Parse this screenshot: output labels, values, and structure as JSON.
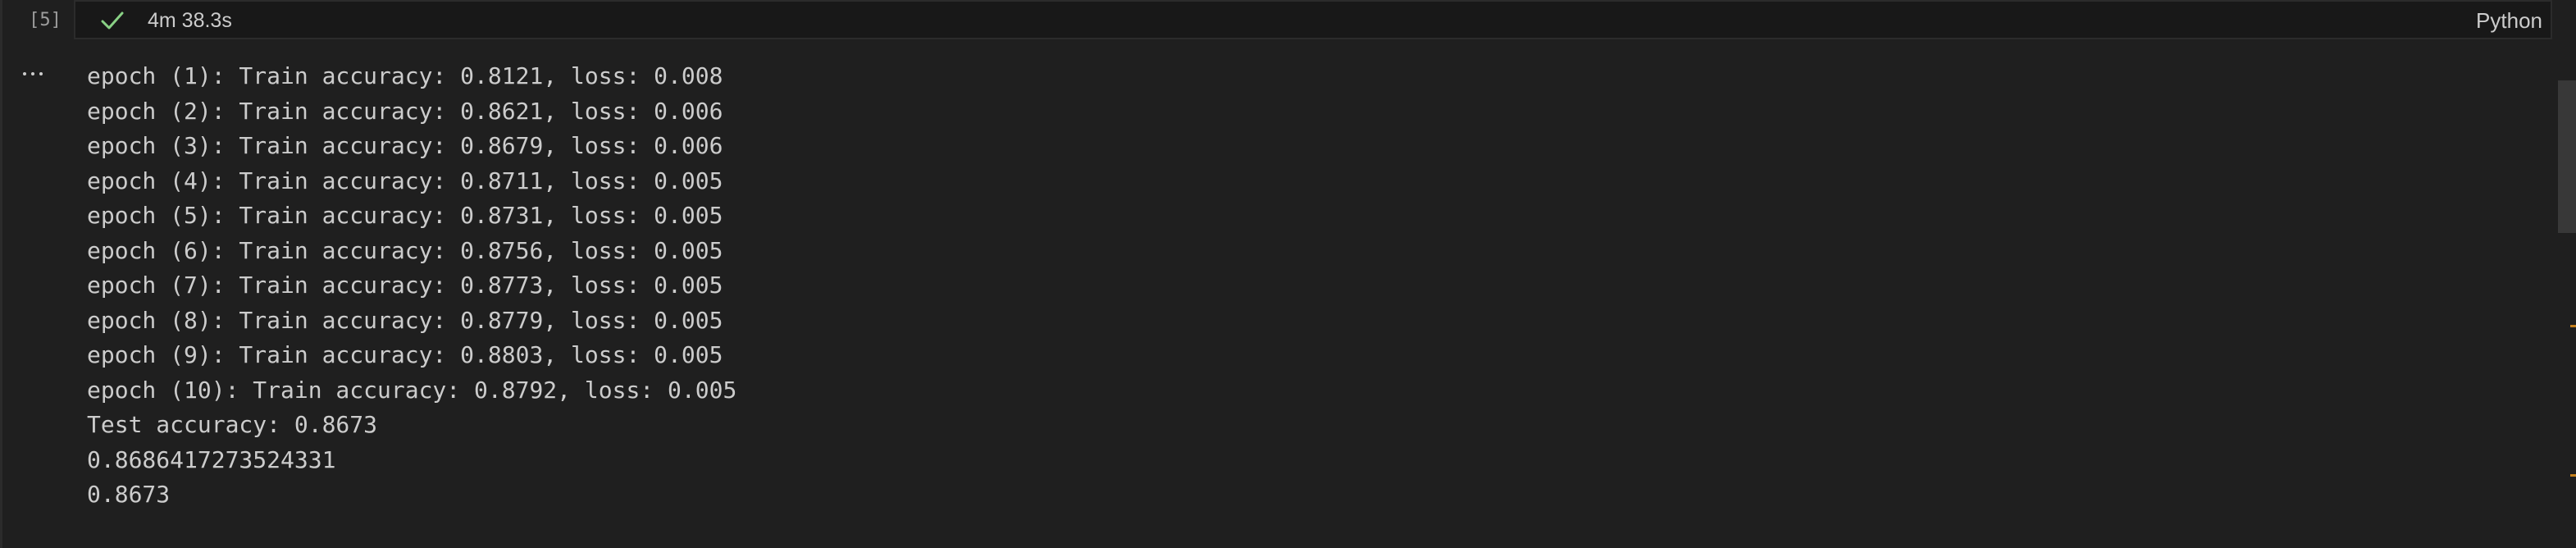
{
  "cell": {
    "execution_count": "[5]",
    "status_icon": "check-icon",
    "status_color": "#89d185",
    "duration": "4m 38.3s",
    "language": "Python",
    "output_menu_icon": "ellipsis-icon"
  },
  "output_lines": [
    "epoch (1): Train accuracy: 0.8121, loss: 0.008",
    "epoch (2): Train accuracy: 0.8621, loss: 0.006",
    "epoch (3): Train accuracy: 0.8679, loss: 0.006",
    "epoch (4): Train accuracy: 0.8711, loss: 0.005",
    "epoch (5): Train accuracy: 0.8731, loss: 0.005",
    "epoch (6): Train accuracy: 0.8756, loss: 0.005",
    "epoch (7): Train accuracy: 0.8773, loss: 0.005",
    "epoch (8): Train accuracy: 0.8779, loss: 0.005",
    "epoch (9): Train accuracy: 0.8803, loss: 0.005",
    "epoch (10): Train accuracy: 0.8792, loss: 0.005",
    "Test accuracy: 0.8673",
    "0.8686417273524331",
    "0.8673"
  ],
  "theme": {
    "background": "#1f1f1f",
    "text": "#cccccc",
    "overview_marker": "#c5801c"
  }
}
